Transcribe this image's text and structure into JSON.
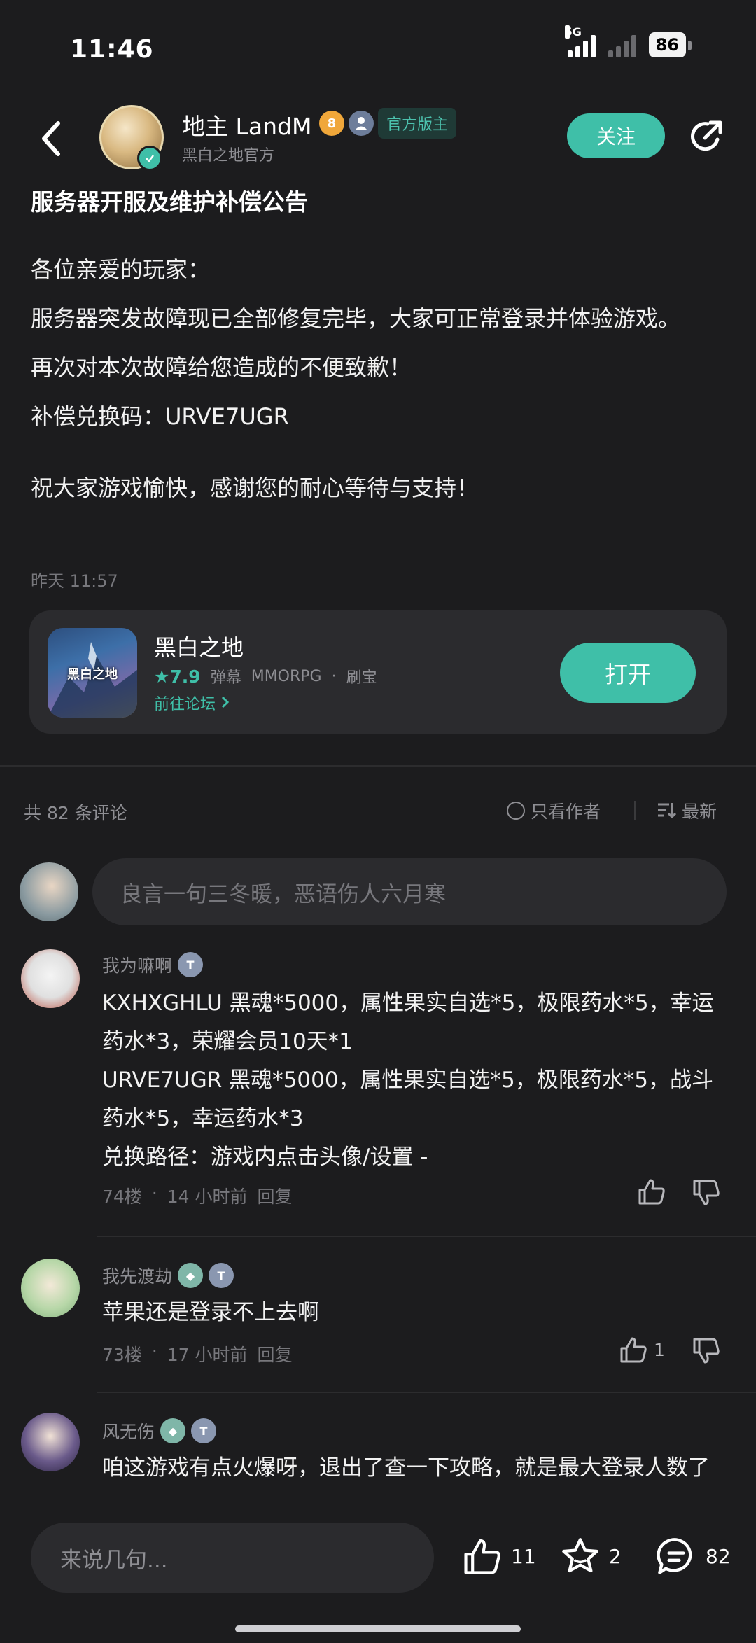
{
  "status": {
    "time": "11:46",
    "network": "5G",
    "battery": "86"
  },
  "header": {
    "author_name": "地主 LandM",
    "author_sub": "黑白之地官方",
    "level_badge": "8",
    "official_badge": "官方版主",
    "follow_label": "关注"
  },
  "post": {
    "title": "服务器开服及维护补偿公告",
    "lines": [
      "各位亲爱的玩家：",
      "服务器突发故障现已全部修复完毕，大家可正常登录并体验游戏。",
      "再次对本次故障给您造成的不便致歉！",
      "补偿兑换码：URVE7UGR"
    ],
    "closing": "祝大家游戏愉快，感谢您的耐心等待与支持！",
    "time": "昨天 11:57"
  },
  "game": {
    "name": "黑白之地",
    "icon_text": "黑白之地",
    "rating": "★7.9",
    "tags": [
      "弹幕",
      "MMORPG",
      "刷宝"
    ],
    "separator": "·",
    "forum_link": "前往论坛",
    "open_label": "打开"
  },
  "comments_header": {
    "count": "共 82 条评论",
    "only_author": "只看作者",
    "sort": "最新"
  },
  "comment_input": {
    "placeholder": "良言一句三冬暖，恶语伤人六月寒"
  },
  "comments": [
    {
      "name": "我为嘛啊",
      "lines": [
        "KXHXGHLU 黑魂*5000，属性果实自选*5，极限药水*5，幸运药水*3，荣耀会员10天*1",
        "URVE7UGR 黑魂*5000，属性果实自选*5，极限药水*5，战斗药水*5，幸运药水*3",
        "兑换路径：游戏内点击头像/设置 -"
      ],
      "floor": "74楼",
      "time": "14 小时前",
      "reply": "回复",
      "likes": ""
    },
    {
      "name": "我先渡劫",
      "lines": [
        "苹果还是登录不上去啊"
      ],
      "floor": "73楼",
      "time": "17 小时前",
      "reply": "回复",
      "likes": "1"
    },
    {
      "name": "风无伤",
      "lines": [
        "咱这游戏有点火爆呀，退出了查一下攻略，就是最大登录人数了"
      ],
      "floor": "",
      "time": "",
      "reply": "",
      "likes": ""
    }
  ],
  "meta_separator": "·",
  "bottom_bar": {
    "placeholder": "来说几句...",
    "likes": "11",
    "favorites": "2",
    "comments": "82"
  },
  "colors": {
    "accent": "#3fbfa8",
    "background": "#1c1c1e",
    "card": "#2b2b2e"
  }
}
